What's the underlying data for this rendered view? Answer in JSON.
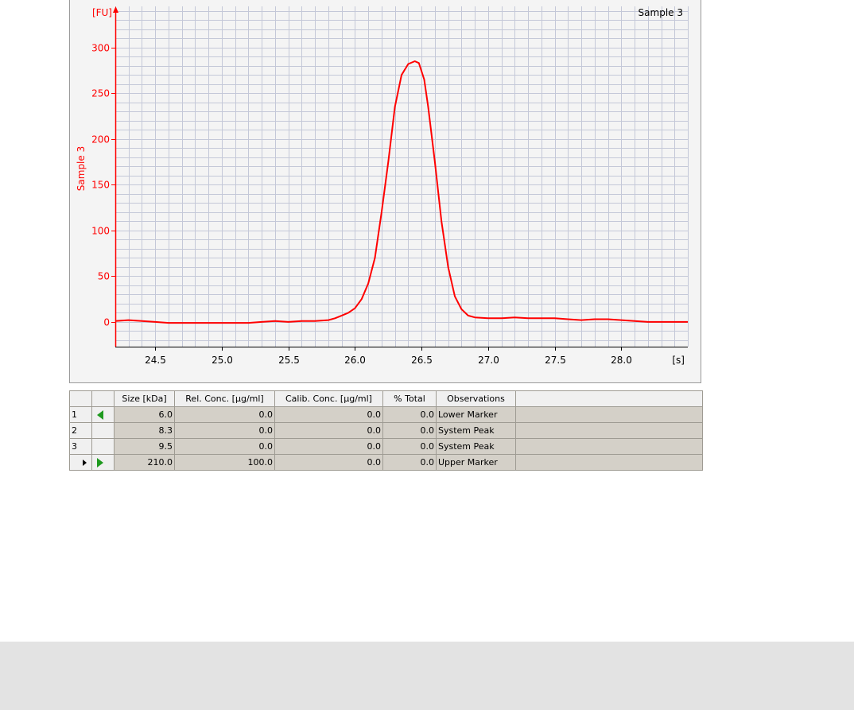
{
  "chart_data": {
    "type": "line",
    "title": "Sample 3",
    "ylabel": "Sample 3",
    "y_unit_label": "[FU]",
    "x_unit_label": "[s]",
    "xlim": [
      24.2,
      28.5
    ],
    "ylim": [
      -27,
      345
    ],
    "x_ticks": [
      24.5,
      25.0,
      25.5,
      26.0,
      26.5,
      27.0,
      27.5,
      28.0
    ],
    "x_tick_labels": [
      "24.5",
      "25.0",
      "25.5",
      "26.0",
      "26.5",
      "27.0",
      "27.5",
      "28.0"
    ],
    "y_ticks": [
      0,
      50,
      100,
      150,
      200,
      250,
      300
    ],
    "y_tick_labels": [
      "0",
      "50",
      "100",
      "150",
      "200",
      "250",
      "300"
    ],
    "grid": true,
    "colors": {
      "series": "#ff0000",
      "axis": "#ff0000",
      "grid": "#c4c8d8",
      "plot_bg": "#f4f4f4"
    },
    "series": [
      {
        "x": [
          24.2,
          24.3,
          24.4,
          24.5,
          24.6,
          24.8,
          25.0,
          25.1,
          25.2,
          25.3,
          25.4,
          25.5,
          25.6,
          25.7,
          25.8,
          25.85,
          25.9,
          25.95,
          26.0,
          26.05,
          26.1,
          26.15,
          26.2,
          26.25,
          26.3,
          26.35,
          26.4,
          26.45,
          26.48,
          26.52,
          26.55,
          26.6,
          26.65,
          26.7,
          26.75,
          26.8,
          26.85,
          26.9,
          27.0,
          27.1,
          27.2,
          27.3,
          27.4,
          27.5,
          27.6,
          27.7,
          27.8,
          27.9,
          28.0,
          28.1,
          28.2,
          28.3,
          28.5
        ],
        "y": [
          1,
          2,
          1,
          0,
          -1,
          -1,
          -1,
          -1,
          -1,
          0,
          1,
          0,
          1,
          1,
          2,
          4,
          7,
          10,
          15,
          25,
          42,
          70,
          120,
          175,
          235,
          270,
          282,
          285,
          283,
          265,
          235,
          175,
          110,
          60,
          28,
          14,
          7,
          5,
          4,
          4,
          5,
          4,
          4,
          4,
          3,
          2,
          3,
          3,
          2,
          1,
          0,
          0,
          0
        ]
      }
    ]
  },
  "table": {
    "headers": [
      "",
      "",
      "Size [kDa]",
      "Rel. Conc. [µg/ml]",
      "Calib. Conc. [µg/ml]",
      "% Total",
      "Observations",
      ""
    ],
    "rows": [
      {
        "index": "1",
        "marker": "lower",
        "size": "6.0",
        "rel_conc": "0.0",
        "calib_conc": "0.0",
        "pct_total": "0.0",
        "observation": "Lower Marker"
      },
      {
        "index": "2",
        "marker": "",
        "size": "8.3",
        "rel_conc": "0.0",
        "calib_conc": "0.0",
        "pct_total": "0.0",
        "observation": "System Peak"
      },
      {
        "index": "3",
        "marker": "",
        "size": "9.5",
        "rel_conc": "0.0",
        "calib_conc": "0.0",
        "pct_total": "0.0",
        "observation": "System Peak"
      },
      {
        "index": "",
        "marker": "upper",
        "size": "210.0",
        "rel_conc": "100.0",
        "calib_conc": "0.0",
        "pct_total": "0.0",
        "observation": "Upper Marker",
        "current": true
      }
    ]
  }
}
